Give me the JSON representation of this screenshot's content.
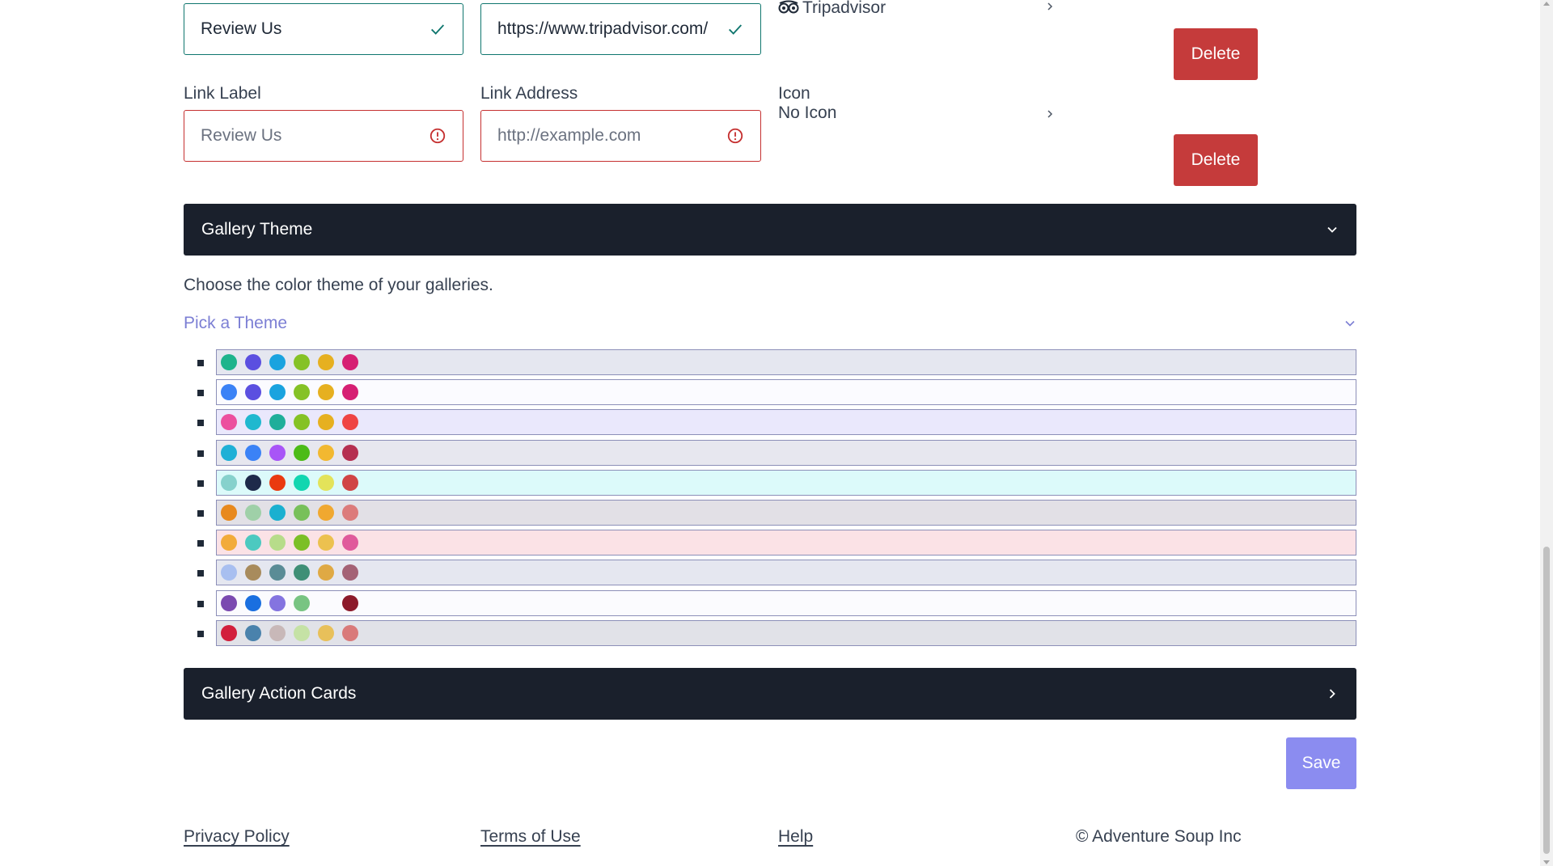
{
  "link_rows": [
    {
      "label_value": "Review Us",
      "address_value": "https://www.tripadvisor.com/",
      "icon_value": "Tripadvisor",
      "icon_name": "tripadvisor-icon",
      "status": "valid",
      "delete_label": "Delete"
    },
    {
      "label_heading": "Link Label",
      "address_heading": "Link Address",
      "icon_heading": "Icon",
      "label_placeholder": "Review Us",
      "address_placeholder": "http://example.com",
      "icon_value": "No Icon",
      "status": "invalid",
      "delete_label": "Delete"
    }
  ],
  "gallery_theme": {
    "title": "Gallery Theme",
    "expanded": true,
    "description": "Choose the color theme of your galleries.",
    "picker_label": "Pick a Theme",
    "themes": [
      {
        "background": "#e5e7f0",
        "colors": [
          "#1eb48c",
          "#5b4fe0",
          "#1aa3df",
          "#85c226",
          "#e6b020",
          "#d61f73"
        ]
      },
      {
        "background": "#fbfbff",
        "colors": [
          "#3b82f6",
          "#5b4fe0",
          "#1aa3df",
          "#85c226",
          "#e6b020",
          "#d61f73"
        ]
      },
      {
        "background": "#eae8fc",
        "colors": [
          "#ec4f9e",
          "#1fb8cf",
          "#1fae9a",
          "#85c226",
          "#e6b020",
          "#ef4444"
        ]
      },
      {
        "background": "#e7e7ef",
        "colors": [
          "#1fb0d6",
          "#3b82f6",
          "#a855f7",
          "#4cbb17",
          "#f2b830",
          "#b52f50"
        ]
      },
      {
        "background": "#dcfafa",
        "colors": [
          "#86d1cc",
          "#1e2a4a",
          "#ea3a0f",
          "#11d6b0",
          "#e3e35a",
          "#d04545"
        ]
      },
      {
        "background": "#e2e0e6",
        "colors": [
          "#e8891e",
          "#9fd0a8",
          "#1ab0d0",
          "#78c05a",
          "#f0a830",
          "#dc7b7b"
        ]
      },
      {
        "background": "#fbe2e6",
        "colors": [
          "#f2ab3a",
          "#4cc9c0",
          "#b7dc8a",
          "#7cbf26",
          "#ecc14f",
          "#e05a9b"
        ]
      },
      {
        "background": "#e5e7f0",
        "colors": [
          "#a8bff0",
          "#a88b5c",
          "#5a8c96",
          "#3f8f76",
          "#dfa944",
          "#a46275"
        ]
      },
      {
        "background": "#fbfbfe",
        "colors": [
          "#7b4ab0",
          "#1a6fe0",
          "#8474e0",
          "#78c482",
          "#fbfbfe",
          "#8c1a2a"
        ]
      },
      {
        "background": "#e1e2e8",
        "colors": [
          "#d21f3c",
          "#4a82ac",
          "#c8b8b8",
          "#c5e2a5",
          "#e8c05a",
          "#d97a7a"
        ]
      }
    ]
  },
  "gallery_action_cards": {
    "title": "Gallery Action Cards",
    "expanded": false
  },
  "save_label": "Save",
  "footer": {
    "privacy": "Privacy Policy",
    "terms": "Terms of Use",
    "help": "Help",
    "copyright": "© Adventure Soup Inc"
  },
  "colors": {
    "section_bar": "#1a202c",
    "delete": "#c53b3b",
    "save": "#8b8cf0",
    "accent_text": "#7c7fd4",
    "valid": "#0f766e",
    "invalid": "#c53030"
  }
}
